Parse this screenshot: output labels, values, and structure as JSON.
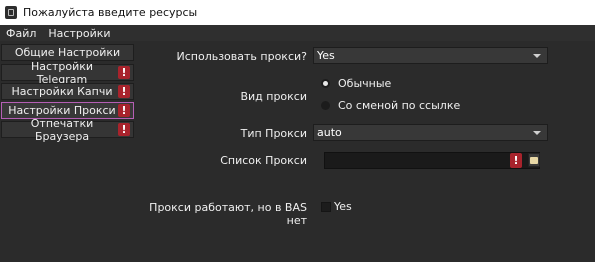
{
  "window": {
    "title": "Пожалуйста введите ресурсы"
  },
  "menu": {
    "items": [
      "Файл",
      "Настройки"
    ]
  },
  "sidebar": {
    "items": [
      {
        "label": "Общие Настройки",
        "warning": false
      },
      {
        "label": "Настройки Telegram",
        "warning": true
      },
      {
        "label": "Настройки Капчи",
        "warning": true
      },
      {
        "label": "Настройки Прокси",
        "warning": true,
        "active": true
      },
      {
        "label": "Отпечатки Браузера",
        "warning": true
      }
    ],
    "warning_glyph": "!"
  },
  "form": {
    "use_proxy": {
      "label": "Использовать прокси?",
      "value": "Yes"
    },
    "proxy_kind": {
      "label": "Вид прокси",
      "options": [
        "Обычные",
        "Со сменой по ссылке"
      ],
      "selected": 0
    },
    "proxy_type": {
      "label": "Тип Прокси",
      "value": "auto"
    },
    "proxy_list": {
      "label": "Список Прокси",
      "value": "",
      "warning_glyph": "!"
    },
    "bas_check": {
      "label": "Прокси работают, но в BAS нет",
      "checkbox_label": "Yes",
      "checked": false
    }
  },
  "colors": {
    "warning": "#a8232c",
    "active_border": "#b55fb5",
    "background": "#2b2b2b"
  }
}
